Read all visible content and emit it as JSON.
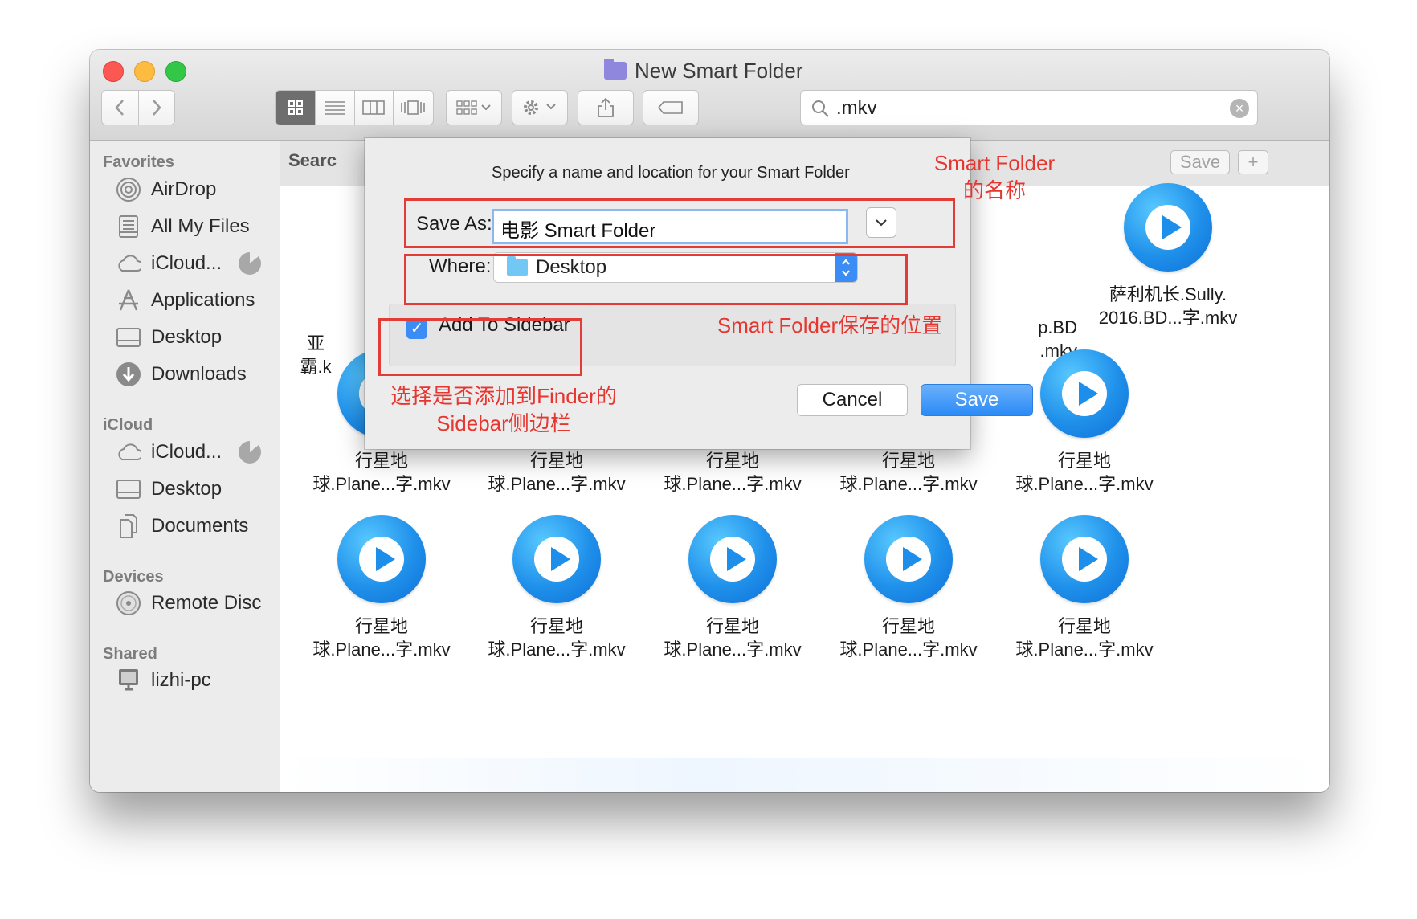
{
  "window": {
    "title": "New Smart Folder",
    "search_query": ".mkv",
    "search_label": "Searc",
    "save_button": "Save",
    "add_button": "+"
  },
  "sidebar": {
    "favorites_title": "Favorites",
    "favorites": [
      {
        "label": "AirDrop",
        "icon": "airdrop-icon"
      },
      {
        "label": "All My Files",
        "icon": "all-files-icon"
      },
      {
        "label": "iCloud...",
        "icon": "cloud-icon"
      },
      {
        "label": "Applications",
        "icon": "applications-icon"
      },
      {
        "label": "Desktop",
        "icon": "desktop-icon"
      },
      {
        "label": "Downloads",
        "icon": "downloads-icon"
      }
    ],
    "icloud_title": "iCloud",
    "icloud": [
      {
        "label": "iCloud...",
        "icon": "cloud-icon"
      },
      {
        "label": "Desktop",
        "icon": "desktop-icon"
      },
      {
        "label": "Documents",
        "icon": "documents-icon"
      }
    ],
    "devices_title": "Devices",
    "devices": [
      {
        "label": "Remote Disc",
        "icon": "disc-icon"
      }
    ],
    "shared_title": "Shared",
    "shared": [
      {
        "label": "lizhi-pc",
        "icon": "computer-icon"
      }
    ]
  },
  "files": {
    "row1": [
      {
        "line1": "亚",
        "line2": "霸.k"
      },
      {
        "line1": "p.BD",
        "line2": ".mkv"
      },
      {
        "line1": "萨利机长.Sully.",
        "line2": "2016.BD...字.mkv"
      }
    ],
    "row2": [
      {
        "line1": "行星地",
        "line2": "球.Plane...字.mkv"
      },
      {
        "line1": "行星地",
        "line2": "球.Plane...字.mkv"
      },
      {
        "line1": "行星地",
        "line2": "球.Plane...字.mkv"
      },
      {
        "line1": "行星地",
        "line2": "球.Plane...字.mkv"
      },
      {
        "line1": "行星地",
        "line2": "球.Plane...字.mkv"
      }
    ],
    "row3": [
      {
        "line1": "行星地",
        "line2": "球.Plane...字.mkv"
      },
      {
        "line1": "行星地",
        "line2": "球.Plane...字.mkv"
      },
      {
        "line1": "行星地",
        "line2": "球.Plane...字.mkv"
      },
      {
        "line1": "行星地",
        "line2": "球.Plane...字.mkv"
      },
      {
        "line1": "行星地",
        "line2": "球.Plane...字.mkv"
      }
    ]
  },
  "dialog": {
    "message": "Specify a name and location for your Smart Folder",
    "save_as_label": "Save As:",
    "save_as_value": "电影 Smart Folder",
    "where_label": "Where:",
    "where_value": "Desktop",
    "sidebar_checkbox_label": "Add To Sidebar",
    "sidebar_checked": true,
    "cancel": "Cancel",
    "save": "Save"
  },
  "annotations": {
    "name_line1": "Smart Folder",
    "name_line2": "的名称",
    "location": "Smart Folder保存的位置",
    "sidebar_line1": "选择是否添加到Finder的",
    "sidebar_line2": "Sidebar侧边栏"
  },
  "colors": {
    "accent": "#3b8cf5",
    "annotation_red": "#e6362f",
    "video_icon": "#1f90ea"
  }
}
